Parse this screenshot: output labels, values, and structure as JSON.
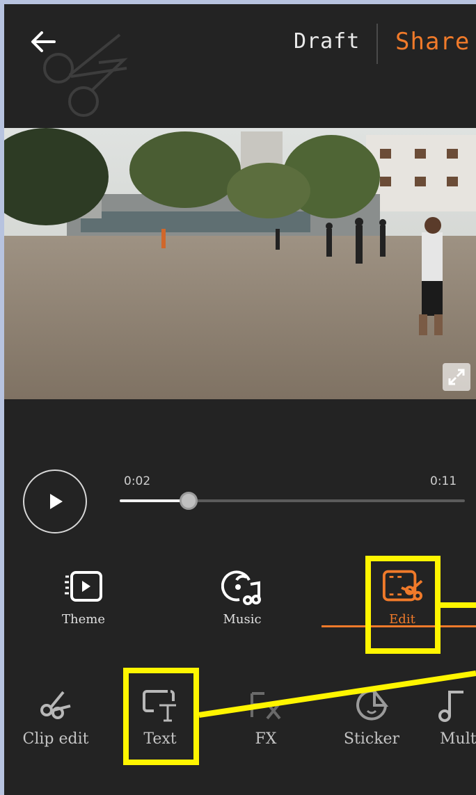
{
  "header": {
    "draft_label": "Draft",
    "share_label": "Share"
  },
  "player": {
    "current_time": "0:02",
    "total_time": "0:11",
    "progress": 0.2
  },
  "tabs": [
    {
      "label": "Theme",
      "icon": "theme-icon",
      "active": false
    },
    {
      "label": "Music",
      "icon": "music-icon",
      "active": false
    },
    {
      "label": "Edit",
      "icon": "edit-icon",
      "active": true
    }
  ],
  "subtools": [
    {
      "label": "Clip edit",
      "icon": "scissors-icon"
    },
    {
      "label": "Text",
      "icon": "text-icon"
    },
    {
      "label": "FX",
      "icon": "fx-icon"
    },
    {
      "label": "Sticker",
      "icon": "sticker-icon"
    },
    {
      "label": "Multi",
      "icon": "music-note-icon"
    }
  ],
  "colors": {
    "accent": "#f07a2a",
    "background": "#232323",
    "annotation": "#fff500"
  }
}
